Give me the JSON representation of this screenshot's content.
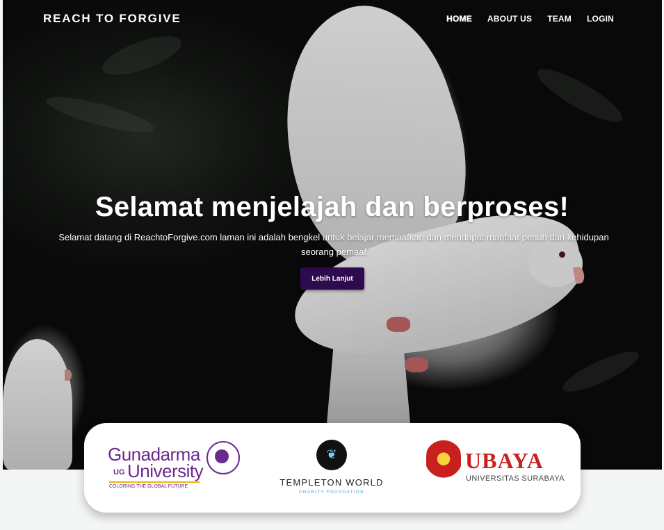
{
  "header": {
    "brand": "REACH TO FORGIVE",
    "nav": [
      {
        "label": "HOME",
        "active": true
      },
      {
        "label": "ABOUT US",
        "active": false
      },
      {
        "label": "TEAM",
        "active": false
      },
      {
        "label": "LOGIN",
        "active": false
      }
    ]
  },
  "hero": {
    "title": "Selamat menjelajah dan berproses!",
    "subtitle": "Selamat datang di ReachtoForgive.com laman ini adalah bengkel untuk belajar memaafkan dan mendapat manfaat penuh dari kehidupan seorang pemaaf",
    "cta_label": "Lebih Lanjut",
    "cta_color": "#2e0a4e"
  },
  "partners": {
    "gunadarma": {
      "name_line1": "Gunadarma",
      "badge": "UG",
      "name_line2": "University",
      "tagline": "COLORING THE GLOBAL FUTURE",
      "color": "#6a2a8e"
    },
    "templeton": {
      "name": "TEMPLETON WORLD",
      "sub": "CHARITY FOUNDATION",
      "icon": "butterfly-icon"
    },
    "ubaya": {
      "name": "UBAYA",
      "sub": "UNIVERSITAS SURABAYA",
      "color": "#c8201f"
    }
  }
}
